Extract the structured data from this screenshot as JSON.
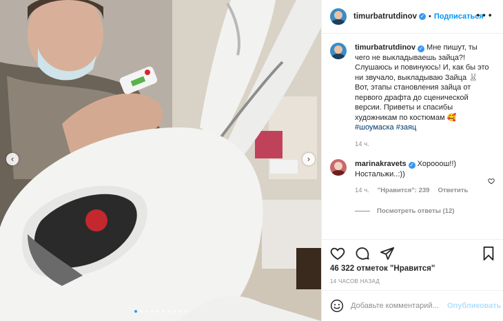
{
  "post": {
    "author": {
      "username": "timurbatrutdinov",
      "verified": true,
      "follow_label": "Подписаться"
    },
    "more_icon": "ellipsis-icon",
    "photo": {
      "carousel_dots": 10,
      "active_dot": 0
    },
    "caption": {
      "username": "timurbatrutdinov",
      "text": " Мне пишут, ты чего не выкладываешь зайца?! Слушаюсь и повинуюсь! И, как бы это ни звучало, выкладываю Зайца 🐰 Вот, этапы становления зайца от первого драфта до сценической версии. Приветы и спасибы художникам по костюмам 🥰",
      "hashtags": "#шоумаска #заяц",
      "time": "14 ч."
    },
    "comments": [
      {
        "username": "marinakravets",
        "verified": true,
        "text": " Хорооош!!) Ностальжи..:))",
        "time": "14 ч.",
        "likes_label": "\"Нравится\": 239",
        "reply_label": "Ответить",
        "view_replies_label": "Посмотреть ответы (12)"
      }
    ],
    "likes_label": "46 322 отметок \"Нравится\"",
    "time_ago": "14 ЧАСОВ НАЗАД",
    "add_comment": {
      "placeholder": "Добавьте комментарий...",
      "publish_label": "Опубликовать"
    },
    "icons": [
      "heart-icon",
      "comment-icon",
      "share-icon",
      "bookmark-icon",
      "emoji-icon"
    ],
    "colors": {
      "accent": "#0095f6",
      "verified": "#3897f0",
      "publish_disabled": "#b2dffc"
    }
  }
}
